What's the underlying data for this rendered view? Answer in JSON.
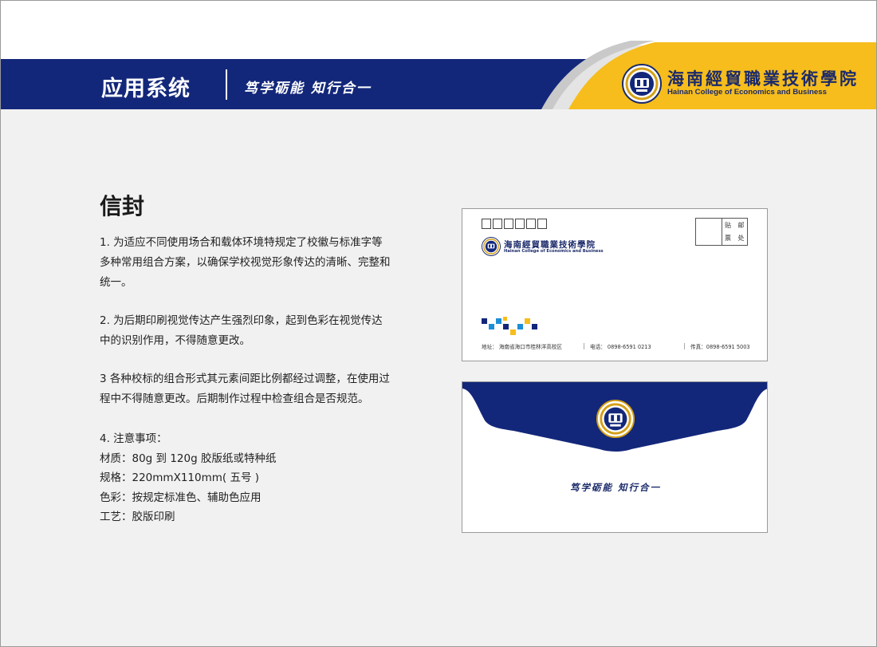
{
  "header": {
    "title": "应用系统",
    "slogan": "笃学砺能 知行合一",
    "brand_cn": "海南經貿職業技術學院",
    "brand_en": "Hainan College of Economics and Business"
  },
  "section": {
    "title": "信封",
    "paragraphs": [
      "1. 为适应不同使用场合和载体环境特规定了校徽与标准字等多种常用组合方案，以确保学校视觉形象传达的清晰、完整和统一。",
      "2. 为后期印刷视觉传达产生强烈印象，起到色彩在视觉传达中的识别作用，不得随意更改。",
      "3 各种校标的组合形式其元素间距比例都经过调整，在使用过程中不得随意更改。后期制作过程中检查组合是否规范。"
    ],
    "notes": [
      "4. 注意事项：",
      "材质：80g 到 120g 胶版纸或特种纸",
      "规格：220mmX110mm( 五号 )",
      "色彩：按规定标准色、辅助色应用",
      "工艺：胶版印刷"
    ]
  },
  "envelope_front": {
    "stamp_line1": "贴 邮",
    "stamp_line2": "票 处",
    "brand_cn": "海南經貿職業技術學院",
    "brand_en": "Hainan College of Economics and Business",
    "address": "地址： 海南省海口市桂林洋高校区",
    "tel": "电话： 0898-6591 0213",
    "fax": "传真：0898-6591 5003"
  },
  "envelope_back": {
    "slogan": "笃学砺能 知行合一"
  },
  "colors": {
    "navy": "#13277a",
    "gold": "#f6bd1c",
    "gray_swoosh": "#b9b9b9",
    "background": "#f1f1f1"
  }
}
